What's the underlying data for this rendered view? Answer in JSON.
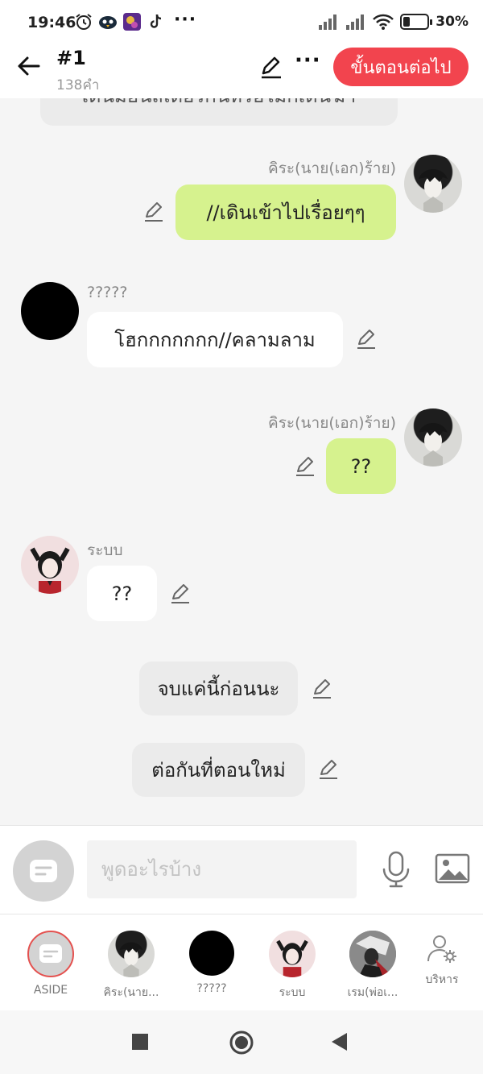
{
  "status_bar": {
    "time": "19:46",
    "more": "···",
    "battery_percent": 30,
    "battery_label": "30%"
  },
  "header": {
    "title": "#1",
    "word_count": "138คำ",
    "next_button": "ขั้นตอนต่อไป",
    "more": "···"
  },
  "chat": {
    "partial_text": "เดินมอนสเตอร์กินหรือไม่ก็เดินฆ่า",
    "messages": [
      {
        "speaker": "คิระ(นาย(เอก)ร้าย)",
        "text": "//เดินเข้าไปเรื่อยๆๆ"
      },
      {
        "speaker": "?????",
        "text": "โฮกกกกกกก//คลามลาม"
      },
      {
        "speaker": "คิระ(นาย(เอก)ร้าย)",
        "text": "??"
      },
      {
        "speaker": "ระบบ",
        "text": "??"
      },
      {
        "speaker": "",
        "text": "จบแค่นี้ก่อนนะ"
      },
      {
        "speaker": "",
        "text": "ต่อกันที่ตอนใหม่"
      }
    ]
  },
  "input": {
    "placeholder": "พูดอะไรบ้าง"
  },
  "characters": [
    {
      "label": "ASIDE"
    },
    {
      "label": "คิระ(นาย..."
    },
    {
      "label": "?????"
    },
    {
      "label": "ระบบ"
    },
    {
      "label": "เรม(พ่อเ..."
    },
    {
      "label": "บริหาร"
    }
  ],
  "colors": {
    "accent": "#f2444e",
    "my_bubble": "#d6f28e",
    "other_bubble": "#ffffff",
    "narration_bubble": "#ebebeb"
  }
}
